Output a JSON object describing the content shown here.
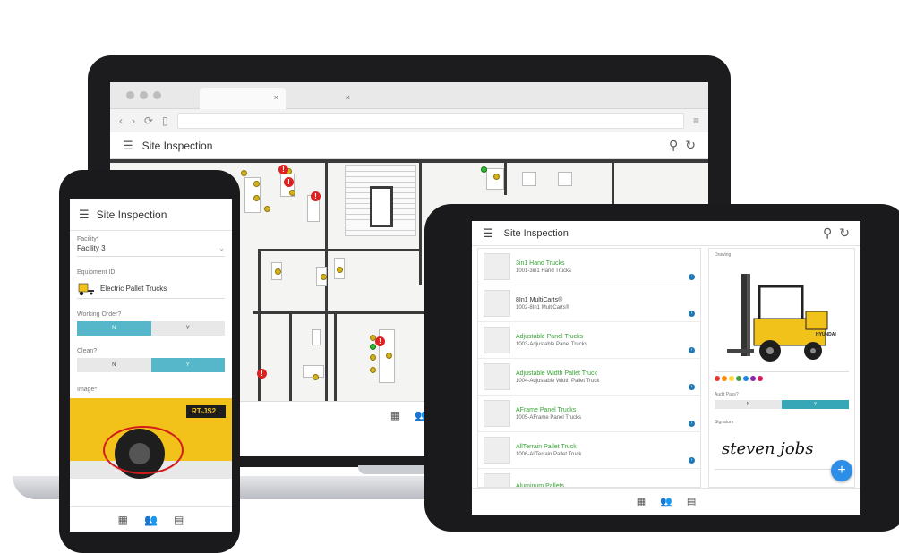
{
  "app": {
    "title": "Site Inspection"
  },
  "laptop": {
    "tabs": [
      {
        "close": "×"
      },
      {
        "close": "×"
      }
    ],
    "icons": {
      "back": "‹",
      "forward": "›",
      "reload": "⟳",
      "page": "▯",
      "menu": "≡",
      "search": "⚲",
      "refresh": "↻",
      "hamburger": "☰"
    },
    "alert_glyph": "!"
  },
  "nav_icons": {
    "calendar": "▦",
    "users": "👥",
    "grid": "▤"
  },
  "phone": {
    "facility_label": "Facility*",
    "facility_value": "Facility 3",
    "equipment_label": "Equipment ID",
    "equipment_value": "Electric Pallet Trucks",
    "working_label": "Working Order?",
    "clean_label": "Clean?",
    "option_n": "N",
    "option_y": "Y",
    "image_label": "Image*",
    "image_badge": "RT-JS2"
  },
  "tablet": {
    "items": [
      {
        "title": "3in1 Hand Trucks",
        "sub": "1001-3in1 Hand Trucks",
        "green": true
      },
      {
        "title": "8In1 MultiCarts®",
        "sub": "1002-8In1 MultiCarts®",
        "green": false
      },
      {
        "title": "Adjustable Panel Trucks",
        "sub": "1003-Adjustable Panel Trucks",
        "green": true
      },
      {
        "title": "Adjustable Width Pallet Truck",
        "sub": "1004-Adjustable Width Pallet Truck",
        "green": true
      },
      {
        "title": "AFrame Panel Trucks",
        "sub": "1005-AFrame Panel Trucks",
        "green": true
      },
      {
        "title": "AllTerrain Pallet Truck",
        "sub": "1006-AllTerrain Pallet Truck",
        "green": true
      },
      {
        "title": "Aluminum Pallets",
        "sub": "",
        "green": true
      }
    ],
    "drawing_label": "Drawing",
    "forklift_brand": "HYUNDAI",
    "audit_label": "Audit Pass?",
    "audit_n": "N",
    "audit_y": "Y",
    "signature_label": "Signature",
    "signature_text": "steven jobs",
    "fab": "+",
    "swatch_colors": [
      "#e53935",
      "#fb8c00",
      "#fdd835",
      "#43a047",
      "#1e88e5",
      "#8e24aa",
      "#d81b60"
    ]
  }
}
